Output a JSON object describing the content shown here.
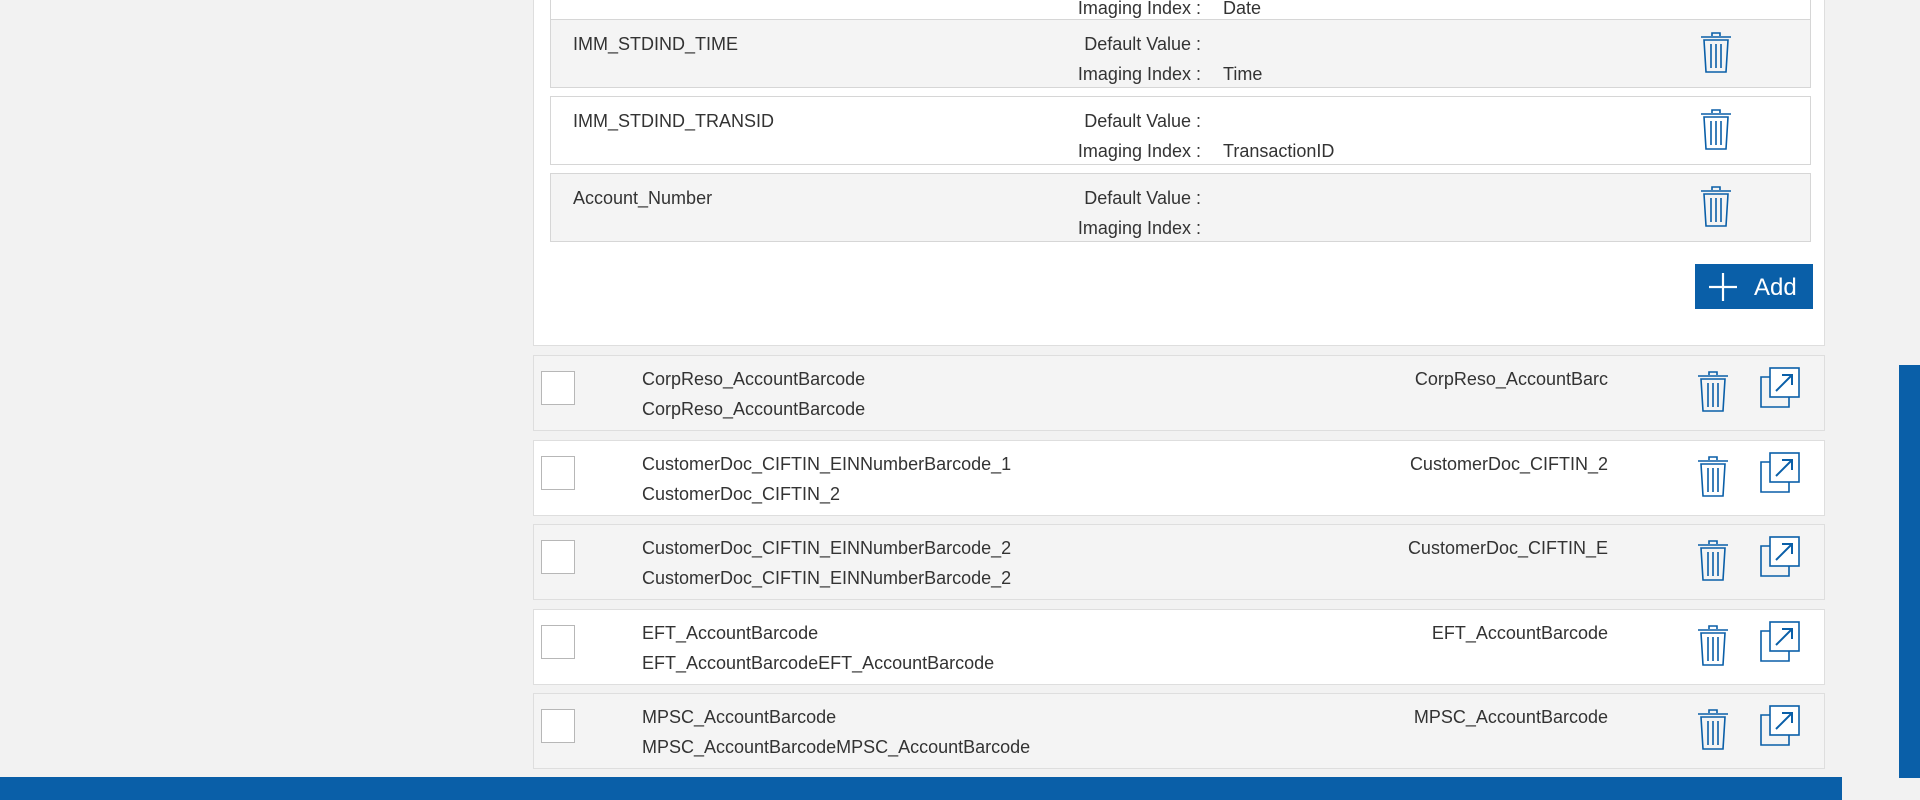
{
  "colors": {
    "accent": "#0a5fa8",
    "row_alt": "#f4f4f4",
    "border": "#d6d6d6"
  },
  "mappings": {
    "default_value_label": "Default Value :",
    "imaging_index_label": "Imaging Index :",
    "partial_top": {
      "label": "Imaging Index :",
      "value": "Date"
    },
    "rows": [
      {
        "name": "IMM_STDIND_TIME",
        "default_value": "",
        "imaging_index": "Time"
      },
      {
        "name": "IMM_STDIND_TRANSID",
        "default_value": "",
        "imaging_index": "TransactionID"
      },
      {
        "name": "Account_Number",
        "default_value": "",
        "imaging_index": ""
      }
    ],
    "add_button": {
      "label": "Add",
      "icon": "plus-icon"
    }
  },
  "items": [
    {
      "title": "CorpReso_AccountBarcode",
      "subtitle": "CorpReso_AccountBarcode",
      "right": "CorpReso_AccountBarc"
    },
    {
      "title": "CustomerDoc_CIFTIN_EINNumberBarcode_1",
      "subtitle": "CustomerDoc_CIFTIN_2",
      "right": "CustomerDoc_CIFTIN_2"
    },
    {
      "title": "CustomerDoc_CIFTIN_EINNumberBarcode_2",
      "subtitle": "CustomerDoc_CIFTIN_EINNumberBarcode_2",
      "right": "CustomerDoc_CIFTIN_E"
    },
    {
      "title": "EFT_AccountBarcode",
      "subtitle": "EFT_AccountBarcodeEFT_AccountBarcode",
      "right": "EFT_AccountBarcode"
    },
    {
      "title": "MPSC_AccountBarcode",
      "subtitle": "MPSC_AccountBarcodeMPSC_AccountBarcode",
      "right": "MPSC_AccountBarcode"
    }
  ],
  "icons": {
    "delete": "trash-icon",
    "open": "open-external-icon"
  }
}
